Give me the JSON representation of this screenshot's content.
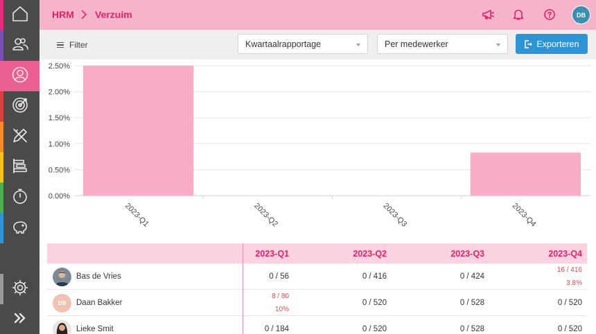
{
  "breadcrumb": {
    "root": "HRM",
    "current": "Verzuim"
  },
  "user": {
    "initials": "DB"
  },
  "toolbar": {
    "filter_label": "Filter",
    "report_select": "Kwartaalrapportage",
    "group_select": "Per medewerker",
    "export_label": "Exporteren"
  },
  "chart_data": {
    "type": "bar",
    "categories": [
      "2023-Q1",
      "2023-Q2",
      "2023-Q3",
      "2023-Q4"
    ],
    "values": [
      2.5,
      0,
      0,
      0.83
    ],
    "y_ticks": [
      "0.00%",
      "0.50%",
      "1.00%",
      "1.50%",
      "2.00%",
      "2.50%"
    ],
    "ylim": [
      0,
      2.5
    ],
    "grid": true,
    "color": "#f9adc6"
  },
  "table": {
    "columns": [
      "2023-Q1",
      "2023-Q2",
      "2023-Q3",
      "2023-Q4"
    ],
    "rows": [
      {
        "name": "Bas de Vries",
        "initials": "",
        "cells": [
          [
            "0 / 56",
            ""
          ],
          [
            "0 / 416",
            ""
          ],
          [
            "0 / 424",
            ""
          ],
          [
            "16 / 416",
            "3.8%"
          ]
        ]
      },
      {
        "name": "Daan Bakker",
        "initials": "DB",
        "cells": [
          [
            "8 / 80",
            "10%"
          ],
          [
            "0 / 520",
            ""
          ],
          [
            "0 / 528",
            ""
          ],
          [
            "0 / 520",
            ""
          ]
        ]
      },
      {
        "name": "Lieke Smit",
        "initials": "",
        "cells": [
          [
            "0 / 184",
            ""
          ],
          [
            "0 / 520",
            ""
          ],
          [
            "0 / 528",
            ""
          ],
          [
            "0 / 520",
            ""
          ]
        ]
      }
    ]
  },
  "sidebar": {
    "items": [
      {
        "icon": "home-icon",
        "strip": "#e52a7b"
      },
      {
        "icon": "people-icon",
        "strip": "#7a4fb4"
      },
      {
        "icon": "user-circle-icon",
        "strip": "#ec5f93"
      },
      {
        "icon": "target-icon",
        "strip": "#d94040"
      },
      {
        "icon": "pencil-ruler-icon",
        "strip": "#f28c28"
      },
      {
        "icon": "timeline-icon",
        "strip": "#f2c21b"
      },
      {
        "icon": "stopwatch-icon",
        "strip": "#4cae4c"
      },
      {
        "icon": "piggy-bank-icon",
        "strip": "#2f94d6"
      },
      {
        "icon": "gear-icon",
        "strip": "#9a9a9a"
      },
      {
        "icon": "double-chevron-right-icon",
        "strip": "#4a4a4a"
      }
    ]
  }
}
